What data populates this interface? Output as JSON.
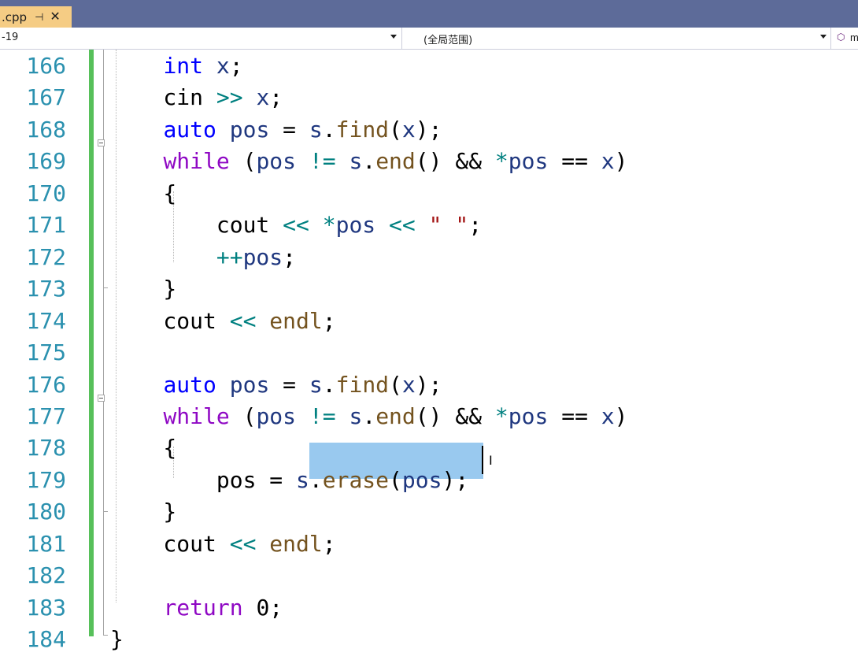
{
  "tab": {
    "name": ".cpp",
    "pin_icon": "pin-icon",
    "close_icon": "close-icon"
  },
  "navbar": {
    "project": "-19",
    "scope": "(全局范围)",
    "member_fragment": "m"
  },
  "code_lines": [
    {
      "num": "166",
      "tokens": [
        {
          "t": "    "
        },
        {
          "t": "int",
          "c": "kw2"
        },
        {
          "t": " "
        },
        {
          "t": "x",
          "c": "var"
        },
        {
          "t": ";"
        }
      ]
    },
    {
      "num": "167",
      "tokens": [
        {
          "t": "    cin "
        },
        {
          "t": ">>",
          "c": "op"
        },
        {
          "t": " "
        },
        {
          "t": "x",
          "c": "var"
        },
        {
          "t": ";"
        }
      ]
    },
    {
      "num": "168",
      "tokens": [
        {
          "t": "    "
        },
        {
          "t": "auto",
          "c": "kw2"
        },
        {
          "t": " "
        },
        {
          "t": "pos",
          "c": "var"
        },
        {
          "t": " = "
        },
        {
          "t": "s",
          "c": "var"
        },
        {
          "t": "."
        },
        {
          "t": "find",
          "c": "fn"
        },
        {
          "t": "("
        },
        {
          "t": "x",
          "c": "var"
        },
        {
          "t": ");"
        }
      ]
    },
    {
      "num": "169",
      "tokens": [
        {
          "t": "    "
        },
        {
          "t": "while",
          "c": "kw"
        },
        {
          "t": " ("
        },
        {
          "t": "pos",
          "c": "var"
        },
        {
          "t": " "
        },
        {
          "t": "!=",
          "c": "op"
        },
        {
          "t": " "
        },
        {
          "t": "s",
          "c": "var"
        },
        {
          "t": "."
        },
        {
          "t": "end",
          "c": "fn"
        },
        {
          "t": "() && "
        },
        {
          "t": "*",
          "c": "op"
        },
        {
          "t": "pos",
          "c": "var"
        },
        {
          "t": " == "
        },
        {
          "t": "x",
          "c": "var"
        },
        {
          "t": ")"
        }
      ]
    },
    {
      "num": "170",
      "tokens": [
        {
          "t": "    {"
        }
      ]
    },
    {
      "num": "171",
      "tokens": [
        {
          "t": "        cout "
        },
        {
          "t": "<<",
          "c": "op"
        },
        {
          "t": " "
        },
        {
          "t": "*",
          "c": "op"
        },
        {
          "t": "pos",
          "c": "var"
        },
        {
          "t": " "
        },
        {
          "t": "<<",
          "c": "op"
        },
        {
          "t": " "
        },
        {
          "t": "\" \"",
          "c": "str"
        },
        {
          "t": ";"
        }
      ]
    },
    {
      "num": "172",
      "tokens": [
        {
          "t": "        "
        },
        {
          "t": "++",
          "c": "op"
        },
        {
          "t": "pos",
          "c": "var"
        },
        {
          "t": ";"
        }
      ]
    },
    {
      "num": "173",
      "tokens": [
        {
          "t": "    }"
        }
      ]
    },
    {
      "num": "174",
      "tokens": [
        {
          "t": "    cout "
        },
        {
          "t": "<<",
          "c": "op"
        },
        {
          "t": " "
        },
        {
          "t": "endl",
          "c": "fn"
        },
        {
          "t": ";"
        }
      ]
    },
    {
      "num": "175",
      "tokens": []
    },
    {
      "num": "176",
      "tokens": [
        {
          "t": "    "
        },
        {
          "t": "auto",
          "c": "kw2"
        },
        {
          "t": " "
        },
        {
          "t": "pos",
          "c": "var"
        },
        {
          "t": " = "
        },
        {
          "t": "s",
          "c": "var"
        },
        {
          "t": "."
        },
        {
          "t": "find",
          "c": "fn"
        },
        {
          "t": "("
        },
        {
          "t": "x",
          "c": "var"
        },
        {
          "t": ");"
        }
      ]
    },
    {
      "num": "177",
      "tokens": [
        {
          "t": "    "
        },
        {
          "t": "while",
          "c": "kw"
        },
        {
          "t": " ("
        },
        {
          "t": "pos",
          "c": "var"
        },
        {
          "t": " "
        },
        {
          "t": "!=",
          "c": "op"
        },
        {
          "t": " "
        },
        {
          "t": "s",
          "c": "var"
        },
        {
          "t": "."
        },
        {
          "t": "end",
          "c": "fn"
        },
        {
          "t": "() && "
        },
        {
          "t": "*",
          "c": "op"
        },
        {
          "t": "pos",
          "c": "var"
        },
        {
          "t": " == "
        },
        {
          "t": "x",
          "c": "var"
        },
        {
          "t": ")"
        }
      ]
    },
    {
      "num": "178",
      "tokens": [
        {
          "t": "    {"
        }
      ]
    },
    {
      "num": "179",
      "tokens": [
        {
          "t": "        "
        },
        {
          "t": "pos",
          "c": "plain"
        },
        {
          "t": " = "
        },
        {
          "t": "s",
          "c": "var"
        },
        {
          "t": "."
        },
        {
          "t": "erase",
          "c": "fn"
        },
        {
          "t": "("
        },
        {
          "t": "pos",
          "c": "var"
        },
        {
          "t": ")"
        },
        {
          "t": ";"
        }
      ]
    },
    {
      "num": "180",
      "tokens": [
        {
          "t": "    }"
        }
      ]
    },
    {
      "num": "181",
      "tokens": [
        {
          "t": "    cout "
        },
        {
          "t": "<<",
          "c": "op"
        },
        {
          "t": " "
        },
        {
          "t": "endl",
          "c": "fn"
        },
        {
          "t": ";"
        }
      ]
    },
    {
      "num": "182",
      "tokens": []
    },
    {
      "num": "183",
      "tokens": [
        {
          "t": "    "
        },
        {
          "t": "return",
          "c": "kw"
        },
        {
          "t": " 0;"
        }
      ]
    },
    {
      "num": "184",
      "tokens": [
        {
          "t": "}"
        }
      ]
    }
  ],
  "colors": {
    "keyword_control": "#8f08c4",
    "keyword": "#0000ff",
    "variable": "#1f377f",
    "function": "#74531f",
    "operator": "#008080",
    "string": "#a31515",
    "line_number": "#2b91af",
    "selection": "#99c9ef",
    "change_bar": "#57c05a",
    "tab_active": "#f5cc84",
    "tabbar_bg": "#5d6b99"
  }
}
